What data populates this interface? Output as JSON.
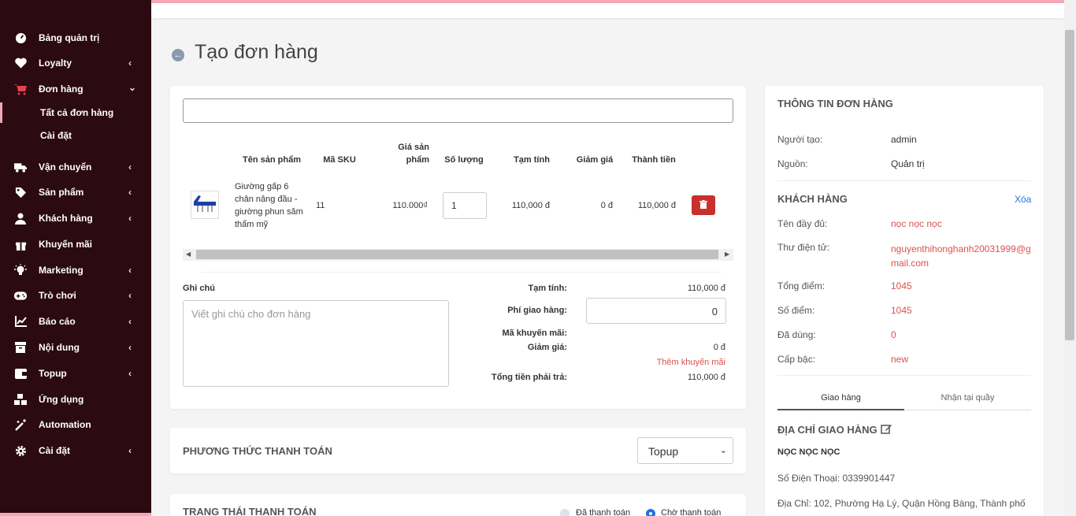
{
  "sidebar": {
    "items": [
      {
        "label": "Bảng quản trị",
        "icon": "dashboard-icon",
        "chevron": ""
      },
      {
        "label": "Loyalty",
        "icon": "heart-icon",
        "chevron": "‹"
      },
      {
        "label": "Đơn hàng",
        "icon": "cart-icon",
        "chevron": "⌄"
      },
      {
        "label": "Vận chuyển",
        "icon": "truck-icon",
        "chevron": "‹"
      },
      {
        "label": "Sản phẩm",
        "icon": "tag-icon",
        "chevron": "‹"
      },
      {
        "label": "Khách hàng",
        "icon": "user-icon",
        "chevron": "‹"
      },
      {
        "label": "Khuyến mãi",
        "icon": "gift-icon",
        "chevron": ""
      },
      {
        "label": "Marketing",
        "icon": "bulb-icon",
        "chevron": "‹"
      },
      {
        "label": "Trò chơi",
        "icon": "gamepad-icon",
        "chevron": "‹"
      },
      {
        "label": "Báo cáo",
        "icon": "chart-icon",
        "chevron": "‹"
      },
      {
        "label": "Nội dung",
        "icon": "archive-icon",
        "chevron": "‹"
      },
      {
        "label": "Topup",
        "icon": "wallet-icon",
        "chevron": "‹"
      },
      {
        "label": "Ứng dụng",
        "icon": "cubes-icon",
        "chevron": ""
      },
      {
        "label": "Automation",
        "icon": "magic-icon",
        "chevron": ""
      },
      {
        "label": "Cài đặt",
        "icon": "gear-icon",
        "chevron": "‹"
      }
    ],
    "subitems": [
      {
        "label": "Tất cả đơn hàng",
        "active": true
      },
      {
        "label": "Cài đặt",
        "active": false
      }
    ]
  },
  "page": {
    "title": "Tạo đơn hàng"
  },
  "products": {
    "headers": {
      "name": "Tên sản phẩm",
      "sku": "Mã SKU",
      "price": "Giá sản phẩm",
      "qty": "Số lượng",
      "subtotal": "Tạm tính",
      "discount": "Giảm giá",
      "total": "Thành tiền"
    },
    "row": {
      "name": "Giường gấp 6 chân nâng đầu - giường phun săm thẩm mỹ",
      "sku": "11",
      "price": "110.000₫",
      "qty": "1",
      "subtotal": "110,000 đ",
      "discount": "0 đ",
      "total": "110,000 đ"
    }
  },
  "note": {
    "label": "Ghi chú",
    "placeholder": "Viết ghi chú cho đơn hàng"
  },
  "summary": {
    "subtotal_label": "Tạm tính:",
    "subtotal_value": "110,000 đ",
    "shipping_label": "Phí giao hàng:",
    "shipping_value": "0",
    "promo_label": "Mã khuyến mãi:",
    "discount_label": "Giảm giá:",
    "discount_value": "0 đ",
    "add_promo": "Thêm khuyến mãi",
    "total_label": "Tổng tiền phải trả:",
    "total_value": "110,000 đ"
  },
  "payment": {
    "title": "PHƯƠNG THỨC THANH TOÁN",
    "selected": "Topup"
  },
  "payment_status": {
    "title": "TRẠNG THÁI THANH TOÁN",
    "options": [
      {
        "label": "Đã thanh toán",
        "checked": false
      },
      {
        "label": "Chờ thanh toán",
        "checked": true
      }
    ]
  },
  "order_info": {
    "title": "THÔNG TIN ĐƠN HÀNG",
    "creator_label": "Người tạo:",
    "creator_value": "admin",
    "source_label": "Nguồn:",
    "source_value": "Quản trị"
  },
  "customer": {
    "title": "KHÁCH HÀNG",
    "delete": "Xóa",
    "fields": [
      {
        "label": "Tên đầy đủ:",
        "value": "nọc nọc nọc"
      },
      {
        "label": "Thư điện tử:",
        "value": "nguyenthihonghanh20031999@gmail.com"
      },
      {
        "label": "Tổng điểm:",
        "value": "1045"
      },
      {
        "label": "Số điểm:",
        "value": "1045"
      },
      {
        "label": "Đã dùng:",
        "value": "0"
      },
      {
        "label": "Cấp bậc:",
        "value": "new"
      }
    ]
  },
  "delivery": {
    "tabs": [
      "Giao hàng",
      "Nhận tại quầy"
    ],
    "address_title": "ĐỊA CHỈ GIAO HÀNG",
    "name": "NỌC NỌC NỌC",
    "phone": "Số Điện Thoại: 0339901447",
    "address": "Địa Chỉ: 102, Phường Hạ Lý, Quận Hồng Bàng, Thành phố"
  },
  "colors": {
    "sidebar_bg": "#2b0a12",
    "accent": "#f2a7b4",
    "danger": "#c8302d",
    "link_red": "#d9534f",
    "blue": "#1a73e8"
  }
}
